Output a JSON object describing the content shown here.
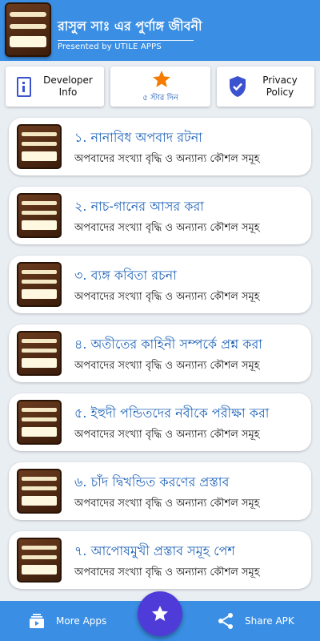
{
  "header": {
    "title": "রাসুল সাঃ এর পুর্ণাঙ্গ জীবনী",
    "subtitle": "Presented by UTILE APPS",
    "logo_icon": "book-cover-icon"
  },
  "top_buttons": {
    "developer": "Developer Info",
    "rate": "৫ স্টার দিন",
    "privacy": "Privacy Policy"
  },
  "chapters": [
    {
      "title": "১. নানাবিধ অপবাদ রটনা",
      "subtitle": "অপবাদের সংখ্যা বৃদ্ধি ও অন্যান্য কৌশল সমূহ"
    },
    {
      "title": "২. নাচ-গানের আসর করা",
      "subtitle": "অপবাদের সংখ্যা বৃদ্ধি ও অন্যান্য কৌশল সমূহ"
    },
    {
      "title": "৩. ব্যঙ্গ কবিতা রচনা",
      "subtitle": "অপবাদের সংখ্যা বৃদ্ধি ও অন্যান্য কৌশল সমূহ"
    },
    {
      "title": "৪. অতীতের কাহিনী সম্পর্কে প্রশ্ন করা",
      "subtitle": "অপবাদের সংখ্যা বৃদ্ধি ও অন্যান্য কৌশল সমূহ"
    },
    {
      "title": "৫. ইহুদী পন্ডিতদের নবীকে পরীক্ষা করা",
      "subtitle": "অপবাদের সংখ্যা বৃদ্ধি ও অন্যান্য কৌশল সমূহ"
    },
    {
      "title": "৬. চাঁদ দ্বিখন্ডিত করণের প্রস্তাব",
      "subtitle": "অপবাদের সংখ্যা বৃদ্ধি ও অন্যান্য কৌশল সমূহ"
    },
    {
      "title": "৭. আপোষমুখী প্রস্তাব সমূহ পেশ",
      "subtitle": "অপবাদের সংখ্যা বৃদ্ধি ও অন্যান্য কৌশল সমূহ"
    }
  ],
  "bottom_bar": {
    "more_apps": "More Apps",
    "share": "Share APK"
  },
  "colors": {
    "primary": "#3a8fe4",
    "accent": "#4f3bd8",
    "title_text": "#1f63b8",
    "star": "#f57c00"
  }
}
